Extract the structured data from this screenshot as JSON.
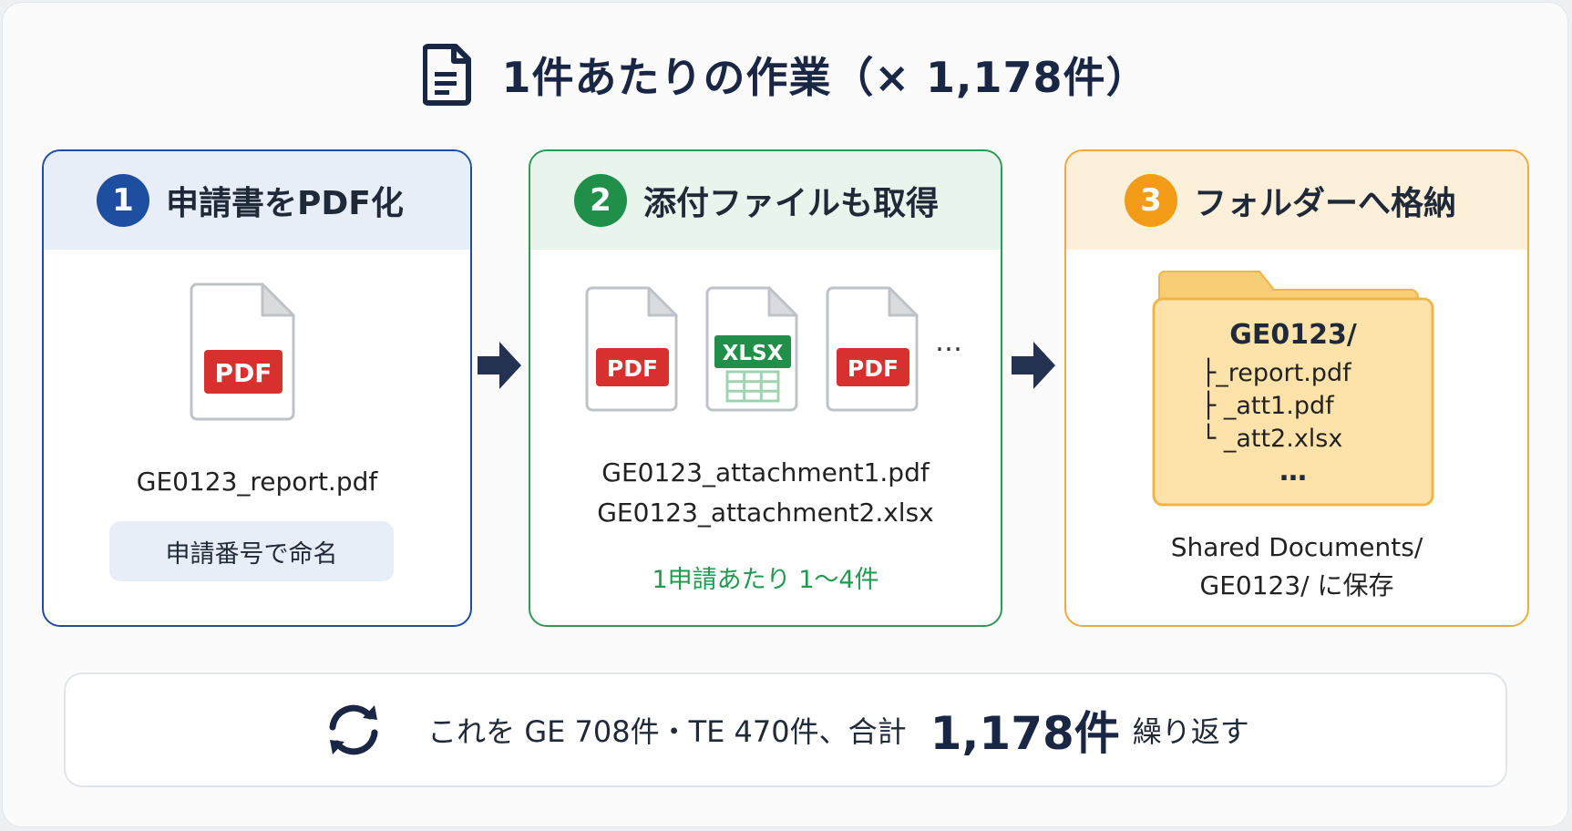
{
  "title": "1件あたりの作業（× 1,178件）",
  "steps": [
    {
      "number": "1",
      "title": "申請書をPDF化",
      "file_label": "PDF",
      "file_name": "GE0123_report.pdf",
      "pill": "申請番号で命名"
    },
    {
      "number": "2",
      "title": "添付ファイルも取得",
      "files": [
        "PDF",
        "XLSX",
        "PDF"
      ],
      "more": "…",
      "file_names": [
        "GE0123_attachment1.pdf",
        "GE0123_attachment2.xlsx"
      ],
      "note": "1申請あたり 1～4件"
    },
    {
      "number": "3",
      "title": "フォルダーへ格納",
      "folder_name": "GE0123/",
      "tree": [
        "├_report.pdf",
        "├ _att1.pdf",
        "└ _att2.xlsx"
      ],
      "more": "…",
      "save_lines": [
        "Shared Documents/",
        "GE0123/ に保存"
      ]
    }
  ],
  "summary": {
    "lead": "これを GE 708件・TE 470件、合計",
    "total": "1,178件",
    "tail": "繰り返す"
  },
  "colors": {
    "step1": "#1e4ea0",
    "step2": "#1f8f49",
    "step3": "#f29b16",
    "pdf_red": "#d8302f",
    "xlsx_green": "#1f8f49",
    "navy": "#1a2744"
  }
}
